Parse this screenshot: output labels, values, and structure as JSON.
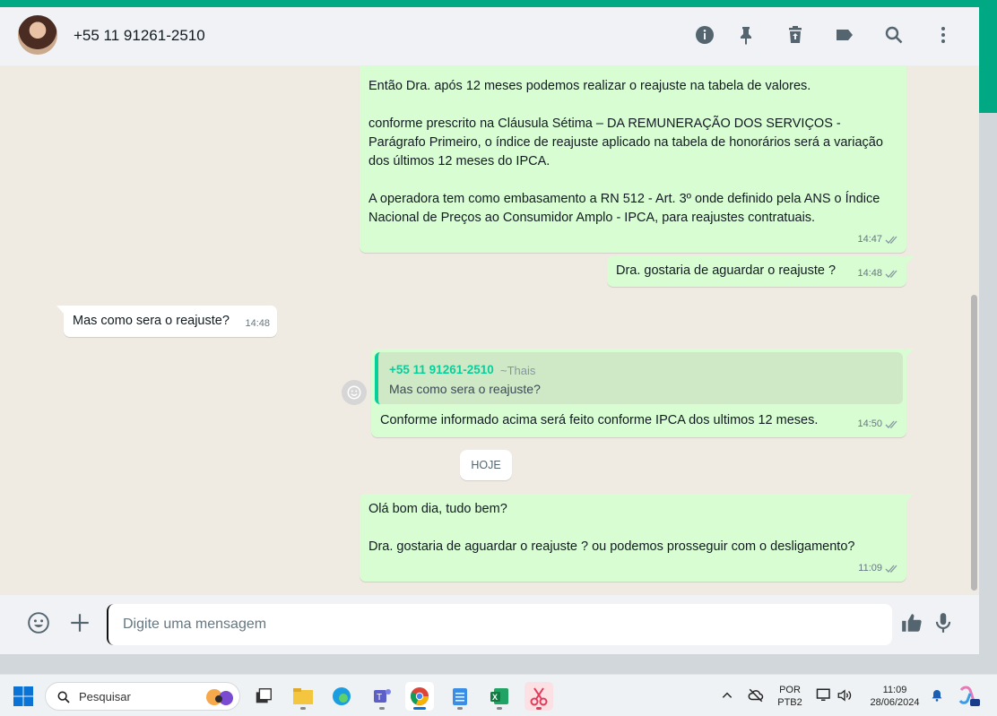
{
  "header": {
    "contact_name": "+55 11 91261-2510",
    "icons": [
      "info-icon",
      "pin-icon",
      "delete-icon",
      "label-icon",
      "search-icon",
      "menu-icon"
    ]
  },
  "messages": [
    {
      "type": "out",
      "text": "Então Dra. após 12 meses podemos realizar o reajuste na tabela de valores.\n\nconforme prescrito na Cláusula Sétima – DA REMUNERAÇÃO DOS SERVIÇOS - Parágrafo Primeiro, o índice de reajuste aplicado na tabela de honorários será a variação dos últimos 12 meses do IPCA.\n\nA operadora tem como embasamento a RN 512 - Art. 3º onde definido pela ANS o Índice Nacional de Preços ao Consumidor Amplo - IPCA, para reajustes contratuais.",
      "time": "14:47"
    },
    {
      "type": "out",
      "text": "Dra. gostaria de aguardar o reajuste ?",
      "time": "14:48"
    },
    {
      "type": "in",
      "text": "Mas como sera o reajuste?",
      "time": "14:48"
    },
    {
      "type": "out",
      "quote_name": "+55 11 91261-2510",
      "quote_alias": "~Thais",
      "quote_text": "Mas como sera o reajuste?",
      "text": "Conforme informado acima será feito conforme IPCA dos ultimos 12 meses.",
      "time": "14:50"
    },
    {
      "type": "out",
      "text": "Olá bom dia, tudo bem?\n\nDra. gostaria de aguardar o reajuste ? ou podemos prosseguir com o desligamento?",
      "time": "11:09"
    }
  ],
  "date_divider": "HOJE",
  "footer": {
    "placeholder": "Digite uma mensagem"
  },
  "taskbar": {
    "search_label": "Pesquisar",
    "lang_top": "POR",
    "lang_bottom": "PTB2",
    "clock_time": "11:09",
    "clock_date": "28/06/2024"
  },
  "colors": {
    "accent": "#00a884",
    "bubble_out": "#d9fdd3",
    "bubble_in": "#ffffff",
    "chat_bg": "#efeae2"
  }
}
